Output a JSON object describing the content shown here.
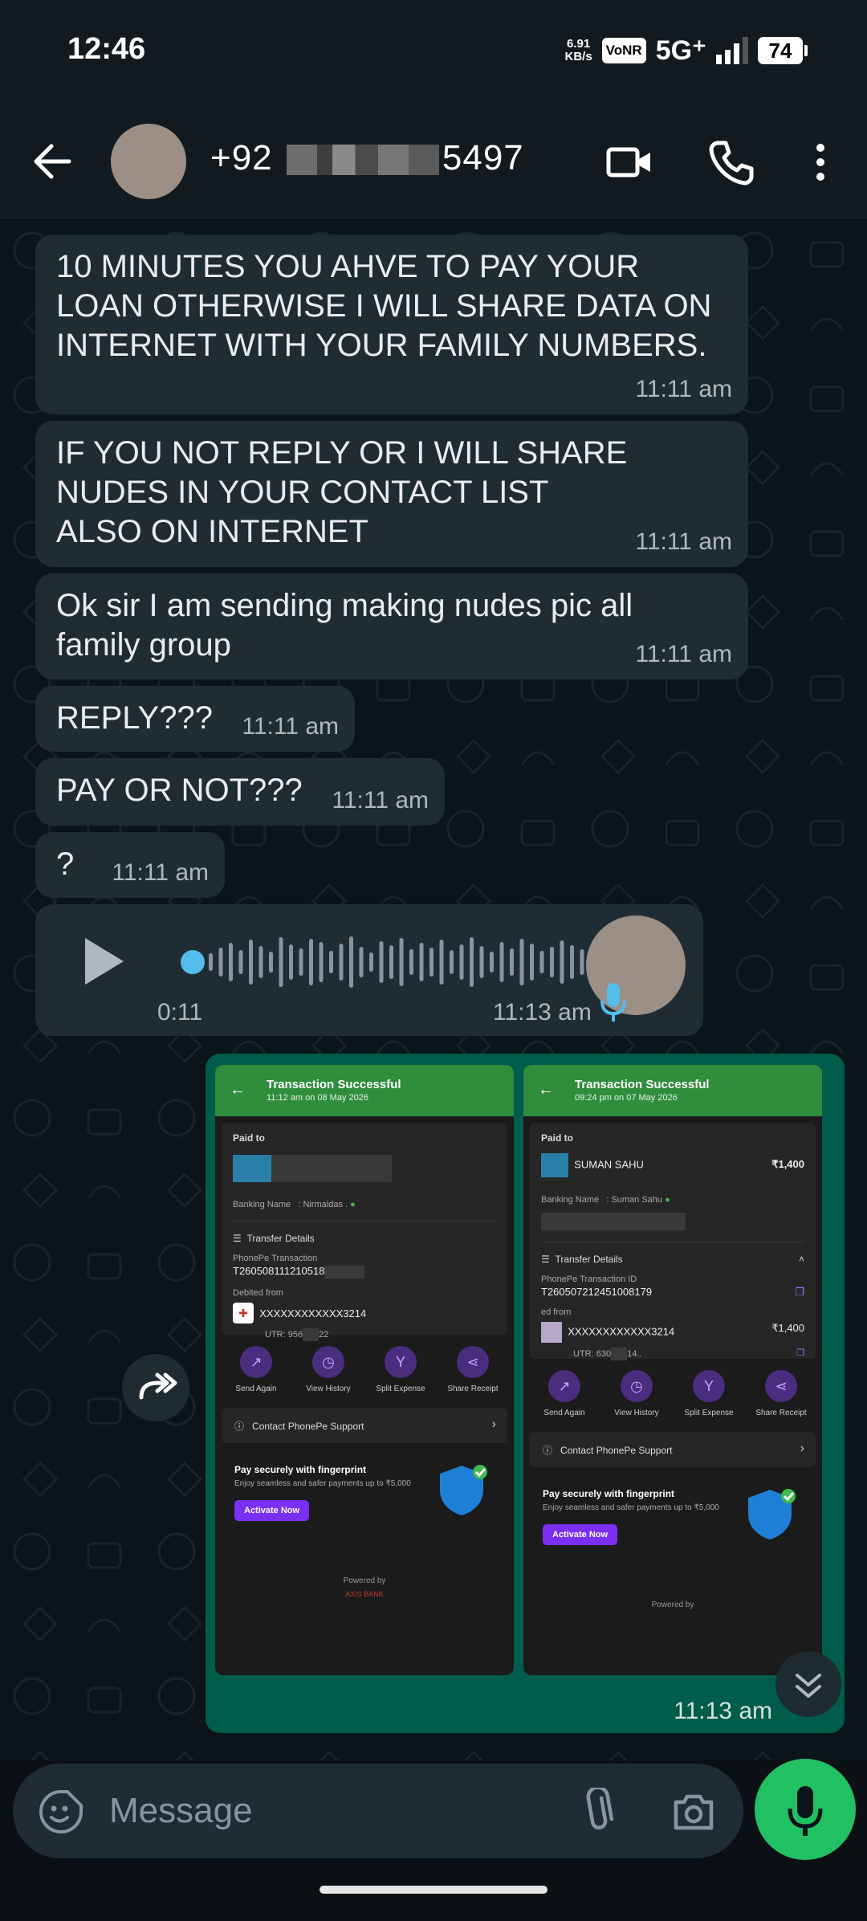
{
  "status_bar": {
    "time": "12:46",
    "speed_value": "6.91",
    "speed_unit": "KB/s",
    "volte": "VoNR",
    "network": "5G⁺",
    "battery": "74"
  },
  "header": {
    "contact_prefix": "+92",
    "contact_suffix": "5497",
    "icons": [
      "back-arrow-icon",
      "video-call-icon",
      "phone-call-icon",
      "more-options-icon"
    ]
  },
  "messages": [
    {
      "text": "10 MINUTES YOU AHVE TO PAY YOUR\nLOAN OTHERWISE I WILL SHARE DATA ON\nINTERNET WITH YOUR FAMILY NUMBERS.",
      "time": "11:11 am"
    },
    {
      "text": "IF YOU NOT REPLY OR I WILL SHARE\nNUDES IN YOUR CONTACT LIST\nALSO ON INTERNET",
      "time": "11:11 am"
    },
    {
      "text": "Ok sir I am sending making nudes pic all\nfamily group",
      "time": "11:11 am"
    },
    {
      "text": "REPLY???",
      "time": "11:11 am"
    },
    {
      "text": "PAY OR NOT???",
      "time": "11:11 am"
    },
    {
      "text": "?",
      "time": "11:11 am"
    }
  ],
  "voice_note": {
    "position": "0:11",
    "time": "11:13 am"
  },
  "image_message": {
    "time": "11:13 am",
    "shots": [
      {
        "title": "Transaction Successful",
        "subtitle": "11:12 am on 08 May 2026",
        "paid_to": "Paid to",
        "payee": "",
        "amount": "",
        "banking_name_label": "Banking Name",
        "banking_name": ": Nirmaldas .",
        "transfer_details": "Transfer Details",
        "txn_id_label": "PhonePe Transaction",
        "txn_id": "T260508111210518",
        "debited_from": "Debited from",
        "account": "XXXXXXXXXXXX3214",
        "utr": "UTR: 956",
        "utr_tail": "22",
        "actions": [
          "Send Again",
          "View History",
          "Split Expense",
          "Share Receipt"
        ],
        "support": "Contact PhonePe Support",
        "fp_title": "Pay securely with fingerprint",
        "fp_desc": "Enjoy seamless and safer payments up to ₹5,000",
        "fp_button": "Activate Now",
        "powered": "Powered by",
        "bank": "AXIS BANK"
      },
      {
        "title": "Transaction Successful",
        "subtitle": "09:24 pm on 07 May 2026",
        "paid_to": "Paid to",
        "payee": "SUMAN  SAHU",
        "amount": "₹1,400",
        "banking_name_label": "Banking Name",
        "banking_name": ": Suman  Sahu",
        "transfer_details": "Transfer Details",
        "txn_id_label": "PhonePe Transaction ID",
        "txn_id": "T260507212451008179",
        "debited_from": "ed from",
        "account": "XXXXXXXXXXXX3214",
        "account_amount": "₹1,400",
        "utr": "UTR: 630",
        "utr_tail": "14..",
        "actions": [
          "Send Again",
          "View History",
          "Split Expense",
          "Share Receipt"
        ],
        "support": "Contact PhonePe Support",
        "fp_title": "Pay securely with fingerprint",
        "fp_desc": "Enjoy seamless and safer payments up to ₹5,000",
        "fp_button": "Activate Now",
        "powered": "Powered by"
      }
    ]
  },
  "composer": {
    "placeholder": "Message"
  },
  "colors": {
    "accent": "#21c063",
    "bubble_in": "#202c33",
    "bubble_out": "#005c4b",
    "background": "#0b141a"
  }
}
